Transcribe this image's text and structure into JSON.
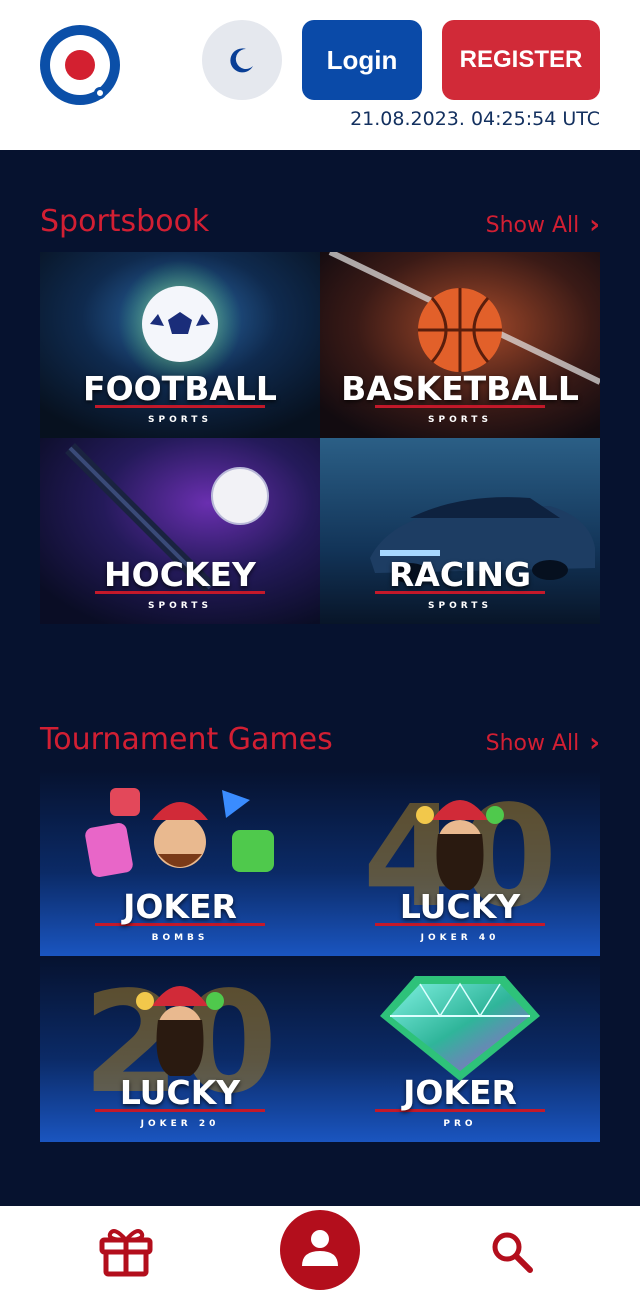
{
  "header": {
    "login_label": "Login",
    "register_label": "REGISTER",
    "datetime": "21.08.2023. 04:25:54 UTC"
  },
  "sportsbook": {
    "title": "Sportsbook",
    "show_all": "Show All",
    "tiles": [
      {
        "title": "FOOTBALL",
        "subtitle": "SPORTS"
      },
      {
        "title": "BASKETBALL",
        "subtitle": "SPORTS"
      },
      {
        "title": "HOCKEY",
        "subtitle": "SPORTS"
      },
      {
        "title": "RACING",
        "subtitle": "SPORTS"
      }
    ]
  },
  "tournament": {
    "title": "Tournament Games",
    "show_all": "Show All",
    "tiles": [
      {
        "title": "JOKER",
        "subtitle": "BOMBS"
      },
      {
        "title": "LUCKY",
        "subtitle": "JOKER 40",
        "bg_number": "40"
      },
      {
        "title": "LUCKY",
        "subtitle": "JOKER 20",
        "bg_number": "20"
      },
      {
        "title": "JOKER",
        "subtitle": "PRO"
      }
    ]
  },
  "colors": {
    "brand_blue": "#0a4aa8",
    "brand_red": "#d12a38",
    "page_bg": "#06122f"
  },
  "icons": {
    "theme": "moon-icon",
    "show_all": "chevron-right-icon",
    "nav_gift": "gift-icon",
    "nav_profile": "user-icon",
    "nav_search": "search-icon"
  }
}
